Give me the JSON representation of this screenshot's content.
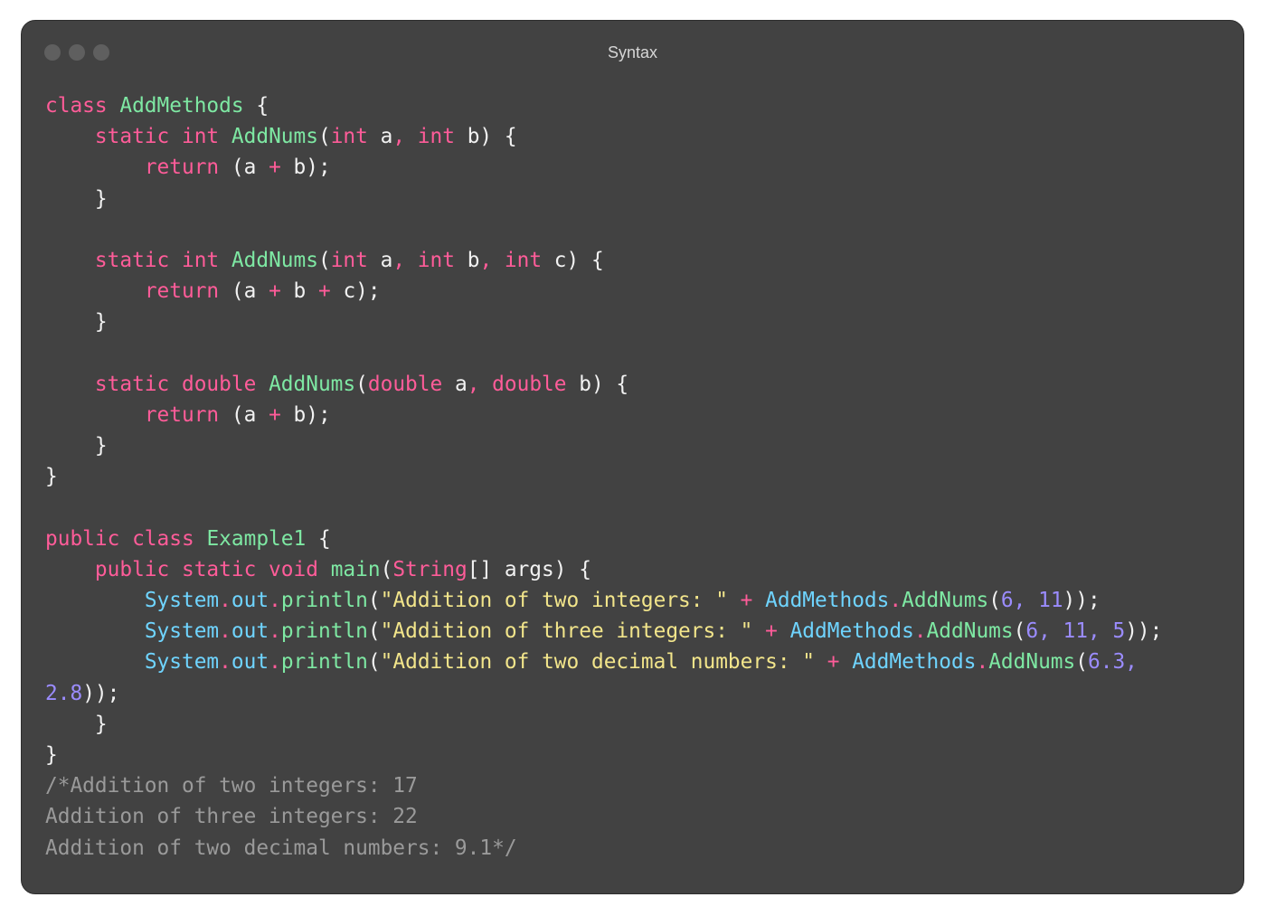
{
  "window": {
    "title": "Syntax",
    "traffic_lights": [
      "close",
      "minimize",
      "zoom"
    ]
  },
  "colors": {
    "keyword": "#ff5c99",
    "function": "#7ee8a3",
    "type": "#6fd4ff",
    "string": "#f2e58b",
    "number": "#9b8cff",
    "comment": "#9a9a9a",
    "plain": "#f2f2f2",
    "background": "#424242"
  },
  "code": {
    "lines": [
      [
        [
          "kw",
          "class "
        ],
        [
          "fn",
          "AddMethods"
        ],
        [
          "pl",
          " {"
        ]
      ],
      [
        [
          "pl",
          "    "
        ],
        [
          "kw",
          "static int "
        ],
        [
          "fn",
          "AddNums"
        ],
        [
          "pl",
          "("
        ],
        [
          "kw",
          "int "
        ],
        [
          "pl",
          "a"
        ],
        [
          "op",
          ", "
        ],
        [
          "kw",
          "int "
        ],
        [
          "pl",
          "b) {"
        ]
      ],
      [
        [
          "pl",
          "        "
        ],
        [
          "kw",
          "return "
        ],
        [
          "pl",
          "(a "
        ],
        [
          "op",
          "+ "
        ],
        [
          "pl",
          "b);"
        ]
      ],
      [
        [
          "pl",
          "    }"
        ]
      ],
      [],
      [
        [
          "pl",
          "    "
        ],
        [
          "kw",
          "static int "
        ],
        [
          "fn",
          "AddNums"
        ],
        [
          "pl",
          "("
        ],
        [
          "kw",
          "int "
        ],
        [
          "pl",
          "a"
        ],
        [
          "op",
          ", "
        ],
        [
          "kw",
          "int "
        ],
        [
          "pl",
          "b"
        ],
        [
          "op",
          ", "
        ],
        [
          "kw",
          "int "
        ],
        [
          "pl",
          "c) {"
        ]
      ],
      [
        [
          "pl",
          "        "
        ],
        [
          "kw",
          "return "
        ],
        [
          "pl",
          "(a "
        ],
        [
          "op",
          "+ "
        ],
        [
          "pl",
          "b "
        ],
        [
          "op",
          "+ "
        ],
        [
          "pl",
          "c);"
        ]
      ],
      [
        [
          "pl",
          "    }"
        ]
      ],
      [],
      [
        [
          "pl",
          "    "
        ],
        [
          "kw",
          "static double "
        ],
        [
          "fn",
          "AddNums"
        ],
        [
          "pl",
          "("
        ],
        [
          "kw",
          "double "
        ],
        [
          "pl",
          "a"
        ],
        [
          "op",
          ", "
        ],
        [
          "kw",
          "double "
        ],
        [
          "pl",
          "b) {"
        ]
      ],
      [
        [
          "pl",
          "        "
        ],
        [
          "kw",
          "return "
        ],
        [
          "pl",
          "(a "
        ],
        [
          "op",
          "+ "
        ],
        [
          "pl",
          "b);"
        ]
      ],
      [
        [
          "pl",
          "    }"
        ]
      ],
      [
        [
          "pl",
          "}"
        ]
      ],
      [],
      [
        [
          "kw",
          "public class "
        ],
        [
          "fn",
          "Example1"
        ],
        [
          "pl",
          " {"
        ]
      ],
      [
        [
          "pl",
          "    "
        ],
        [
          "kw",
          "public static void "
        ],
        [
          "fn",
          "main"
        ],
        [
          "pl",
          "("
        ],
        [
          "kw",
          "String"
        ],
        [
          "pl",
          "[] args) {"
        ]
      ],
      [
        [
          "pl",
          "        "
        ],
        [
          "ty",
          "System"
        ],
        [
          "op",
          "."
        ],
        [
          "ty",
          "out"
        ],
        [
          "op",
          "."
        ],
        [
          "fn",
          "println"
        ],
        [
          "pl",
          "("
        ],
        [
          "str",
          "\"Addition of two integers: \" "
        ],
        [
          "op",
          "+ "
        ],
        [
          "ty",
          "AddMethods"
        ],
        [
          "op",
          "."
        ],
        [
          "fn",
          "AddNums"
        ],
        [
          "pl",
          "("
        ],
        [
          "num",
          "6, 11"
        ],
        [
          "pl",
          "));"
        ]
      ],
      [
        [
          "pl",
          "        "
        ],
        [
          "ty",
          "System"
        ],
        [
          "op",
          "."
        ],
        [
          "ty",
          "out"
        ],
        [
          "op",
          "."
        ],
        [
          "fn",
          "println"
        ],
        [
          "pl",
          "("
        ],
        [
          "str",
          "\"Addition of three integers: \" "
        ],
        [
          "op",
          "+ "
        ],
        [
          "ty",
          "AddMethods"
        ],
        [
          "op",
          "."
        ],
        [
          "fn",
          "AddNums"
        ],
        [
          "pl",
          "("
        ],
        [
          "num",
          "6, 11, 5"
        ],
        [
          "pl",
          "));"
        ]
      ],
      [
        [
          "pl",
          "        "
        ],
        [
          "ty",
          "System"
        ],
        [
          "op",
          "."
        ],
        [
          "ty",
          "out"
        ],
        [
          "op",
          "."
        ],
        [
          "fn",
          "println"
        ],
        [
          "pl",
          "("
        ],
        [
          "str",
          "\"Addition of two decimal numbers: \" "
        ],
        [
          "op",
          "+ "
        ],
        [
          "ty",
          "AddMethods"
        ],
        [
          "op",
          "."
        ],
        [
          "fn",
          "AddNums"
        ],
        [
          "pl",
          "("
        ],
        [
          "num",
          "6.3,"
        ]
      ],
      [
        [
          "num",
          "2.8"
        ],
        [
          "pl",
          "));"
        ]
      ],
      [
        [
          "pl",
          "    }"
        ]
      ],
      [
        [
          "pl",
          "}"
        ]
      ],
      [
        [
          "cm",
          "/*Addition of two integers: 17"
        ]
      ],
      [
        [
          "cm",
          "Addition of three integers: 22"
        ]
      ],
      [
        [
          "cm",
          "Addition of two decimal numbers: 9.1*/"
        ]
      ]
    ]
  }
}
